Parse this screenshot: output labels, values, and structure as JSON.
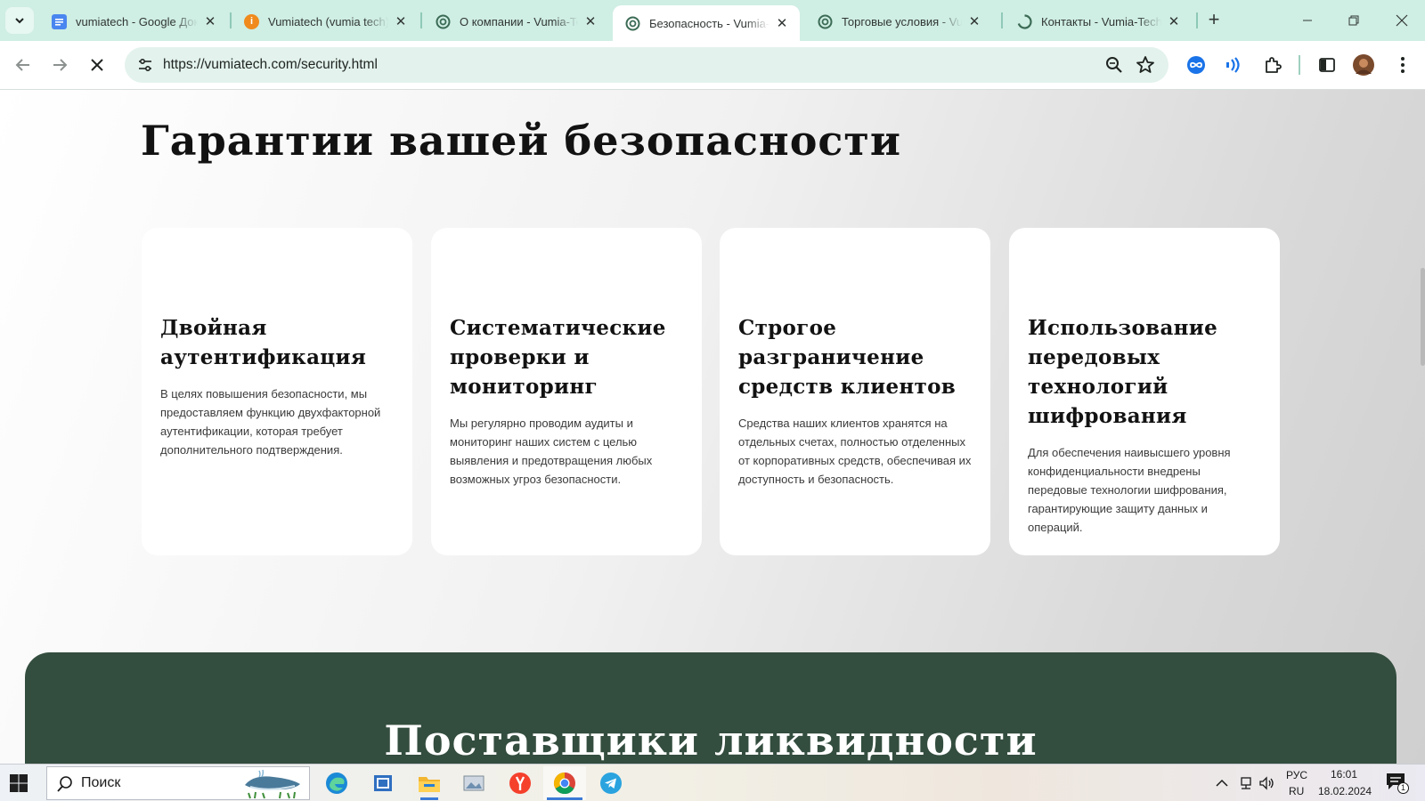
{
  "browser": {
    "tabs": [
      {
        "title": "vumiatech - Google Документы",
        "favicon": "google-docs-icon",
        "active": false
      },
      {
        "title": "Vumiatech (vumia tech)",
        "favicon": "info-orange-icon",
        "active": false
      },
      {
        "title": "О компании - Vumia-Tech",
        "favicon": "vumia-site-icon",
        "active": false
      },
      {
        "title": "Безопасность - Vumia-Tech",
        "favicon": "vumia-site-icon",
        "active": true
      },
      {
        "title": "Торговые условия - Vumia-Tech",
        "favicon": "vumia-site-icon",
        "active": false
      },
      {
        "title": "Контакты - Vumia-Tech",
        "favicon": "loading-icon",
        "active": false
      }
    ],
    "close_glyph": "✕",
    "new_tab_glyph": "+",
    "url": "https://vumiatech.com/security.html",
    "colors": {
      "tabstrip": "#cfeee4",
      "omnibox": "#e3f2ec"
    }
  },
  "page": {
    "section_title": "Гарантии вашей безопасности",
    "cards": [
      {
        "title": "Двойная аутентификация",
        "text": "В целях повышения безопасности, мы предоставляем функцию двухфакторной аутентификации, которая требует дополнительного подтверждения."
      },
      {
        "title": "Систематические проверки и мониторинг",
        "text": "Мы регулярно проводим аудиты и мониторинг наших систем с целью выявления и предотвращения любых возможных угроз безопасности."
      },
      {
        "title": "Строгое разграничение средств клиентов",
        "text": "Средства наших клиентов хранятся на отдельных счетах, полностью отделенных от корпоративных средств, обеспечивая их доступность и безопасность."
      },
      {
        "title": "Использование передовых технологий шифрования",
        "text": "Для обеспечения наивысшего уровня конфиденциальности внедрены передовые технологии шифрования, гарантирующие защиту данных и операций."
      }
    ],
    "next_section_title": "Поставщики ликвидности",
    "colors": {
      "green_block": "#334d3e",
      "card": "#ffffff"
    }
  },
  "taskbar": {
    "search_label": "Поиск",
    "apps": [
      "edge-icon",
      "task-view-icon",
      "file-explorer-icon",
      "photos-icon",
      "yandex-icon",
      "chrome-icon",
      "telegram-icon"
    ],
    "language_top": "РУС",
    "language_bottom": "RU",
    "time": "16:01",
    "date": "18.02.2024",
    "notification_count": "1"
  }
}
